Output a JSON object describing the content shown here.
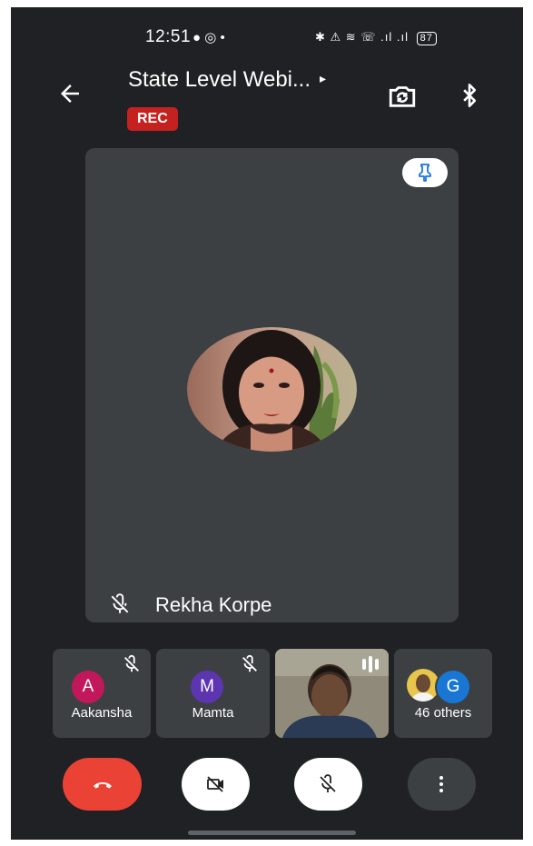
{
  "status_bar": {
    "time": "12:51",
    "notification_icons": "● ◎ •",
    "system_icons": "✱ ⚠ ≋ ☏ .ıl .ıl",
    "battery": "87"
  },
  "header": {
    "title": "State Level Webi...",
    "title_arrow": "▸",
    "rec_badge": "REC"
  },
  "main_speaker": {
    "name": "Rekha Korpe",
    "muted": true
  },
  "participants": [
    {
      "name": "Aakansha",
      "initial": "A",
      "color": "#c2185b",
      "muted": true
    },
    {
      "name": "Mamta",
      "initial": "M",
      "color": "#5e35b1",
      "muted": true
    },
    {
      "name": "",
      "video": true,
      "speaking": true
    },
    {
      "name": "46 others",
      "initial": "G",
      "color": "#1976d2"
    }
  ],
  "colors": {
    "background": "#202124",
    "tile": "#3c4043",
    "end_call": "#ea4335",
    "rec": "#c5221f"
  },
  "icons": [
    "back-arrow-icon",
    "switch-camera-icon",
    "bluetooth-icon",
    "pin-icon",
    "mic-off-icon",
    "end-call-icon",
    "camera-off-icon",
    "more-vert-icon"
  ]
}
